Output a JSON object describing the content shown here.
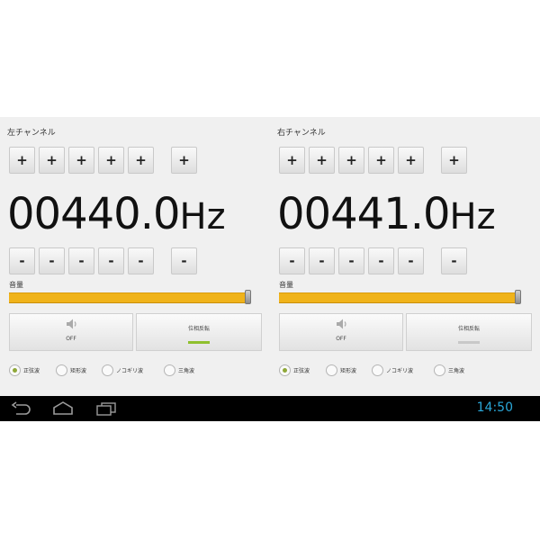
{
  "left": {
    "title": "左チャンネル",
    "plus_buttons": [
      "+",
      "+",
      "+",
      "+",
      "+",
      "+"
    ],
    "frequency": "00440.0",
    "unit": "Hz",
    "minus_buttons": [
      "-",
      "-",
      "-",
      "-",
      "-",
      "-"
    ],
    "volume_label": "音量",
    "volume_level_percent": 100,
    "off_label": "OFF",
    "invert_label": "位相反転",
    "invert_active": true,
    "waveforms": [
      {
        "label": "正弦波",
        "checked": true
      },
      {
        "label": "矩形波",
        "checked": false
      },
      {
        "label": "ノコギリ波",
        "checked": false
      },
      {
        "label": "三角波",
        "checked": false
      }
    ]
  },
  "right": {
    "title": "右チャンネル",
    "plus_buttons": [
      "+",
      "+",
      "+",
      "+",
      "+",
      "+"
    ],
    "frequency": "00441.0",
    "unit": "Hz",
    "minus_buttons": [
      "-",
      "-",
      "-",
      "-",
      "-",
      "-"
    ],
    "volume_label": "音量",
    "volume_level_percent": 100,
    "off_label": "OFF",
    "invert_label": "位相反転",
    "invert_active": false,
    "waveforms": [
      {
        "label": "正弦波",
        "checked": true
      },
      {
        "label": "矩形波",
        "checked": false
      },
      {
        "label": "ノコギリ波",
        "checked": false
      },
      {
        "label": "三角波",
        "checked": false
      }
    ]
  },
  "navbar": {
    "icons": [
      "back-icon",
      "home-icon",
      "recent-apps-icon"
    ],
    "time": "14:50"
  },
  "colors": {
    "slider": "#f0b31a",
    "indicator_on": "#8fc02e",
    "clock": "#2aa7d8"
  }
}
